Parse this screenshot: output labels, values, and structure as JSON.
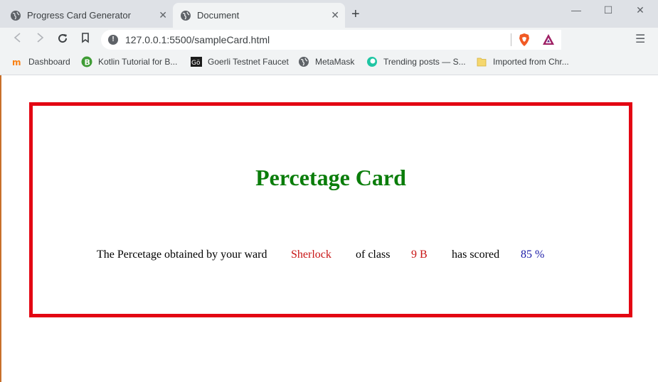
{
  "browser": {
    "tabs": [
      {
        "title": "Progress Card Generator",
        "active": false
      },
      {
        "title": "Document",
        "active": true
      }
    ],
    "new_tab_label": "+",
    "window_controls": {
      "minimize": "—",
      "maximize": "☐",
      "close": "✕"
    },
    "url": "127.0.0.1:5500/sampleCard.html",
    "menu_glyph": "☰",
    "bookmarks": [
      {
        "label": "Dashboard",
        "icon": "moodle-icon"
      },
      {
        "label": "Kotlin Tutorial for B...",
        "icon": "kotlin-b-icon"
      },
      {
        "label": "Goerli Testnet Faucet",
        "icon": "goerli-icon"
      },
      {
        "label": "MetaMask",
        "icon": "globe-icon"
      },
      {
        "label": "Trending posts — S...",
        "icon": "trending-icon"
      },
      {
        "label": "Imported from Chr...",
        "icon": "folder-icon"
      }
    ]
  },
  "card": {
    "title": "Percetage Card",
    "sentence_start": "The Percetage obtained by your ward",
    "student_name": "Sherlock",
    "class_label": "of class",
    "class_value": "9 B",
    "scored_label": "has scored",
    "score": "85 %"
  },
  "colors": {
    "card_border": "#e30613",
    "title": "#0a7d0a",
    "name_value": "#c81414",
    "score_value": "#1a1aa6"
  }
}
